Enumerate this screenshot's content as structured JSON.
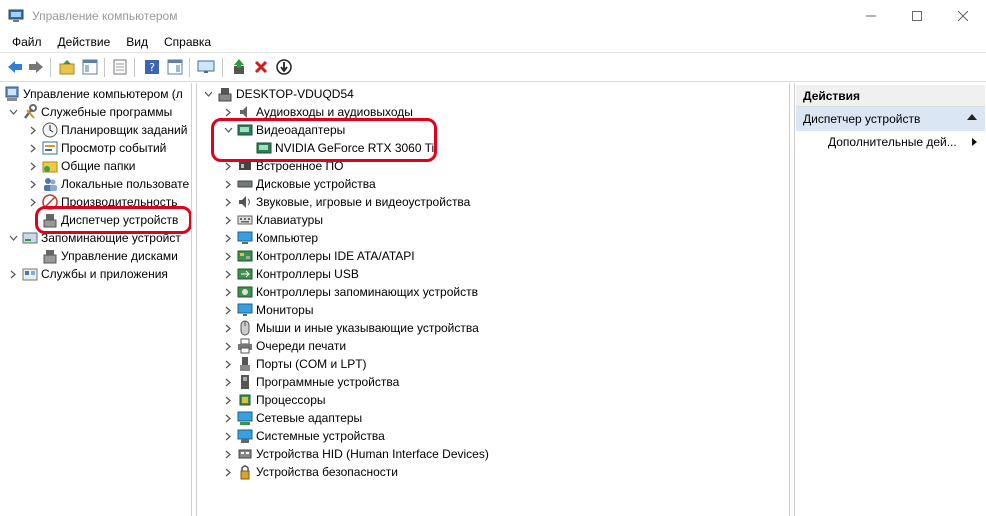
{
  "window": {
    "title": "Управление компьютером",
    "controls": [
      "minimize-icon",
      "maximize-icon",
      "close-icon"
    ]
  },
  "menu": [
    "Файл",
    "Действие",
    "Вид",
    "Справка"
  ],
  "toolbar": {
    "icons": [
      "back-arrow-icon",
      "forward-arrow-icon",
      "up-folder-icon",
      "show-tree-icon",
      "properties-icon",
      "help-icon",
      "show-actions-icon",
      "monitor-icon",
      "update-driver-icon",
      "uninstall-icon",
      "disable-device-icon"
    ],
    "accent_green": "#2e9b3c",
    "delete_red": "#d21b1b"
  },
  "tree": {
    "root": "Управление компьютером (л",
    "system_tools": "Служебные программы",
    "task_scheduler": "Планировщик заданий",
    "event_viewer": "Просмотр событий",
    "shared_folders": "Общие папки",
    "local_users": "Локальные пользовате",
    "performance": "Производительность",
    "device_manager": "Диспетчер устройств",
    "storage": "Запоминающие устройст",
    "disk_management": "Управление дисками",
    "services_apps": "Службы и приложения"
  },
  "devices": {
    "computer_name": "DESKTOP-VDUQD54",
    "categories": [
      {
        "label": "Аудиовходы и аудиовыходы",
        "icon": "audio-icon"
      },
      {
        "label": "Видеоадаптеры",
        "icon": "display-adapter-icon",
        "expanded": true
      },
      {
        "label": "Встроенное ПО",
        "icon": "firmware-icon"
      },
      {
        "label": "Дисковые устройства",
        "icon": "disk-drive-icon"
      },
      {
        "label": "Звуковые, игровые и видеоустройства",
        "icon": "sound-icon"
      },
      {
        "label": "Клавиатуры",
        "icon": "keyboard-icon"
      },
      {
        "label": "Компьютер",
        "icon": "computer-icon"
      },
      {
        "label": "Контроллеры IDE ATA/ATAPI",
        "icon": "ide-controller-icon"
      },
      {
        "label": "Контроллеры USB",
        "icon": "usb-icon"
      },
      {
        "label": "Контроллеры запоминающих устройств",
        "icon": "storage-controller-icon"
      },
      {
        "label": "Мониторы",
        "icon": "monitor-icon"
      },
      {
        "label": "Мыши и иные указывающие устройства",
        "icon": "mouse-icon"
      },
      {
        "label": "Очереди печати",
        "icon": "printer-icon"
      },
      {
        "label": "Порты (COM и LPT)",
        "icon": "port-icon"
      },
      {
        "label": "Программные устройства",
        "icon": "software-device-icon"
      },
      {
        "label": "Процессоры",
        "icon": "processor-icon"
      },
      {
        "label": "Сетевые адаптеры",
        "icon": "network-adapter-icon"
      },
      {
        "label": "Системные устройства",
        "icon": "system-device-icon"
      },
      {
        "label": "Устройства HID (Human Interface Devices)",
        "icon": "hid-icon"
      },
      {
        "label": "Устройства безопасности",
        "icon": "security-device-icon"
      }
    ],
    "gpu": "NVIDIA GeForce RTX 3060 Ti"
  },
  "actions": {
    "header": "Действия",
    "section": "Диспетчер устройств",
    "more": "Дополнительные дей..."
  },
  "colors": {
    "highlight": "#e3001b",
    "selection": "#dbe6f4"
  }
}
